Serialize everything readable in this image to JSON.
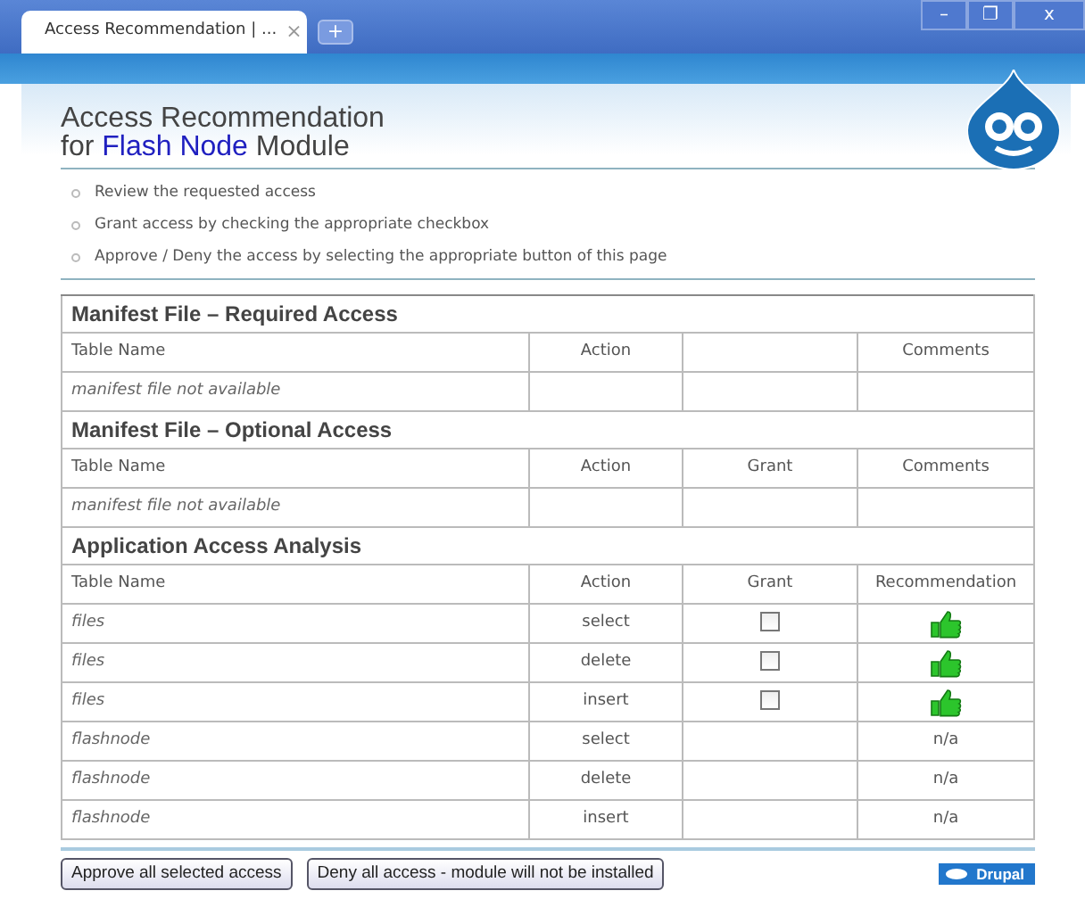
{
  "browser": {
    "tab_title": "Access Recommendation | ...",
    "tab_close": "×",
    "new_tab": "+",
    "controls": [
      "–",
      "❐",
      "x"
    ]
  },
  "page": {
    "title": "Access Recommendation",
    "subtitle_prefix": "for",
    "module": "Flash Node",
    "subtitle_suffix": "Module",
    "steps": [
      "Review the requested access",
      "Grant access by checking the appropriate checkbox",
      "Approve / Deny the access by selecting the appropriate button of this page"
    ],
    "sections": [
      {
        "heading": "Manifest File – Required Access",
        "columns": [
          {
            "label": "Table Name"
          },
          {
            "label": "Action"
          },
          null,
          {
            "label": "Comments"
          }
        ],
        "rows": [
          {
            "cells": [
              {
                "kind": "note",
                "text": "manifest file not available"
              },
              {
                "kind": "empty"
              },
              {
                "kind": "empty"
              },
              {
                "kind": "empty"
              }
            ]
          }
        ]
      },
      {
        "heading": "Manifest File – Optional Access",
        "columns": [
          {
            "label": "Table Name"
          },
          {
            "label": "Action"
          },
          {
            "label": "Grant"
          },
          {
            "label": "Comments"
          }
        ],
        "rows": [
          {
            "cells": [
              {
                "kind": "note",
                "text": "manifest file not available"
              },
              {
                "kind": "empty"
              },
              {
                "kind": "empty"
              },
              {
                "kind": "empty"
              }
            ]
          }
        ]
      },
      {
        "heading": "Application Access Analysis",
        "columns": [
          {
            "label": "Table Name"
          },
          {
            "label": "Action"
          },
          {
            "label": "Grant"
          },
          {
            "label": "Recommendation"
          }
        ],
        "rows": [
          {
            "cells": [
              {
                "kind": "name",
                "text": "files"
              },
              {
                "kind": "text",
                "text": "select"
              },
              {
                "kind": "checkbox",
                "checked": false
              },
              {
                "kind": "thumbs-up"
              }
            ]
          },
          {
            "cells": [
              {
                "kind": "name",
                "text": "files"
              },
              {
                "kind": "text",
                "text": "delete"
              },
              {
                "kind": "checkbox",
                "checked": false
              },
              {
                "kind": "thumbs-up"
              }
            ]
          },
          {
            "cells": [
              {
                "kind": "name",
                "text": "files"
              },
              {
                "kind": "text",
                "text": "insert"
              },
              {
                "kind": "checkbox",
                "checked": false
              },
              {
                "kind": "thumbs-up"
              }
            ]
          },
          {
            "cells": [
              {
                "kind": "name",
                "text": "flashnode"
              },
              {
                "kind": "text",
                "text": "select"
              },
              {
                "kind": "empty"
              },
              {
                "kind": "text",
                "text": "n/a"
              }
            ]
          },
          {
            "cells": [
              {
                "kind": "name",
                "text": "flashnode"
              },
              {
                "kind": "text",
                "text": "delete"
              },
              {
                "kind": "empty"
              },
              {
                "kind": "text",
                "text": "n/a"
              }
            ]
          },
          {
            "cells": [
              {
                "kind": "name",
                "text": "flashnode"
              },
              {
                "kind": "text",
                "text": "insert"
              },
              {
                "kind": "empty"
              },
              {
                "kind": "text",
                "text": "n/a"
              }
            ]
          }
        ]
      }
    ],
    "buttons": [
      "Approve all selected access",
      "Deny all access - module will not be installed"
    ],
    "badge": "Drupal"
  }
}
